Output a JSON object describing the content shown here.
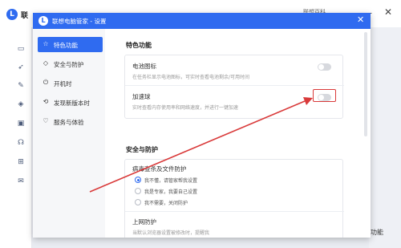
{
  "background": {
    "logo_glyph": "L",
    "logo_text": "联",
    "search_text": "联想百科",
    "min_glyph": "—",
    "close_glyph": "✕",
    "sidebar_icons": [
      "laptop-icon",
      "rocket-icon",
      "brush-icon",
      "shield-icon",
      "tools-icon",
      "headset-icon",
      "briefcase-icon",
      "mail-icon"
    ],
    "bottom_right_text": "功能"
  },
  "dialog": {
    "logo_glyph": "L",
    "title": "联想电脑管家 - 设置",
    "close_glyph": "✕",
    "nav": [
      {
        "icon": "star-icon",
        "glyph": "☆",
        "label": "特色功能",
        "active": true
      },
      {
        "icon": "shield-icon",
        "glyph": "◇",
        "label": "安全与防护",
        "active": false
      },
      {
        "icon": "power-icon",
        "glyph": "⏻",
        "label": "开机时",
        "active": false
      },
      {
        "icon": "update-icon",
        "glyph": "⟲",
        "label": "发现新版本时",
        "active": false
      },
      {
        "icon": "heart-icon",
        "glyph": "♡",
        "label": "服务与体验",
        "active": false
      }
    ],
    "sections": {
      "featured": {
        "title": "特色功能",
        "battery_title": "电池图标",
        "battery_desc": "在任务栏显示电池图标，可实时查看电池剩余/可用时间",
        "battery_on": false,
        "accel_title": "加速球",
        "accel_desc": "实时查看内存使用率和网络速度，并进行一键加速",
        "accel_on": false
      },
      "security": {
        "title": "安全与防护",
        "virus_title": "病毒查杀及文件防护",
        "options": [
          {
            "label": "我不懂，请管家帮我设置",
            "checked": true
          },
          {
            "label": "我是专家，我要自己设置",
            "checked": false
          },
          {
            "label": "我不需要，关闭防护",
            "checked": false
          }
        ],
        "web_title": "上网防护",
        "web_desc": "当默认浏览器设置被修改时，提醒我"
      }
    }
  },
  "annotation": {
    "color": "#d93a3a"
  }
}
